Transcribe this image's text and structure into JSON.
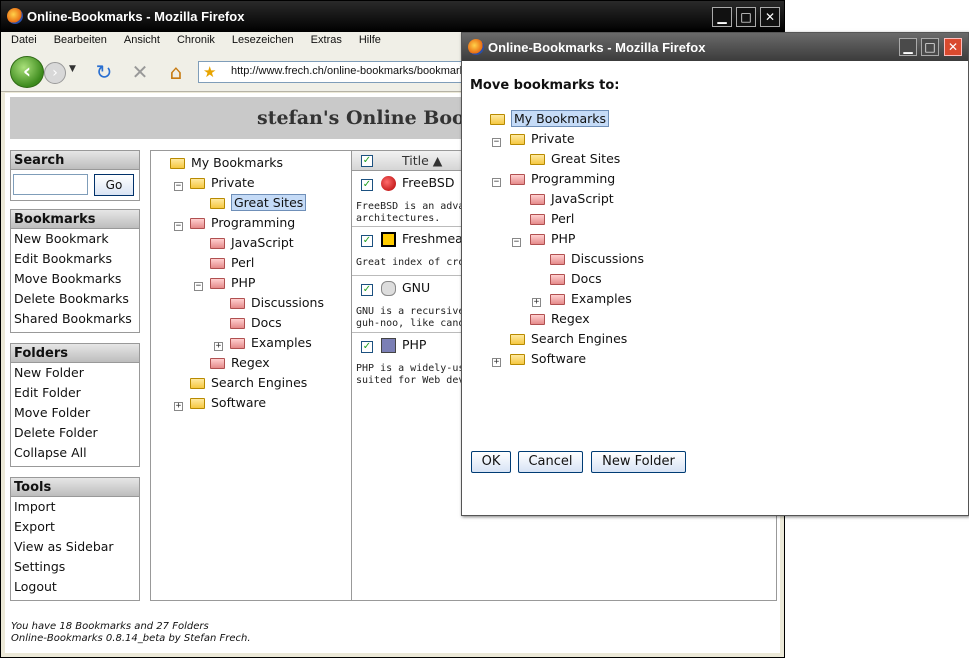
{
  "main_window": {
    "title": "Online-Bookmarks - Mozilla Firefox",
    "menu": [
      "Datei",
      "Bearbeiten",
      "Ansicht",
      "Chronik",
      "Lesezeichen",
      "Extras",
      "Hilfe"
    ],
    "url": "http://www.frech.ch/online-bookmarks/bookmarks.php"
  },
  "page": {
    "heading": "stefan's Online Bookmarks",
    "search": {
      "title": "Search",
      "value": "",
      "button": "Go"
    },
    "bookmarks_box": {
      "title": "Bookmarks",
      "items": [
        "New Bookmark",
        "Edit Bookmarks",
        "Move Bookmarks",
        "Delete Bookmarks",
        "Shared Bookmarks"
      ]
    },
    "folders_box": {
      "title": "Folders",
      "items": [
        "New Folder",
        "Edit Folder",
        "Move Folder",
        "Delete Folder",
        "Collapse All"
      ]
    },
    "tools_box": {
      "title": "Tools",
      "items": [
        "Import",
        "Export",
        "View as Sidebar",
        "Settings",
        "Logout"
      ]
    },
    "tree": [
      "My Bookmarks",
      "Private",
      "Great Sites",
      "Programming",
      "JavaScript",
      "Perl",
      "PHP",
      "Discussions",
      "Docs",
      "Examples",
      "Regex",
      "Search Engines",
      "Software"
    ],
    "list_header": "Title ▲",
    "bookmarks": [
      {
        "title": "FreeBSD",
        "desc1": "FreeBSD is an adva",
        "desc2": "architectures."
      },
      {
        "title": "Freshmea",
        "desc1": "Great index of cros",
        "desc2": ""
      },
      {
        "title": "GNU",
        "desc1": "GNU is a recursive ",
        "desc2": "guh-noo, like canoe"
      },
      {
        "title": "PHP",
        "desc1": "PHP is a widely-use",
        "desc2": "suited for Web dev"
      }
    ],
    "footer_1": "You have 18 Bookmarks and 27 Folders",
    "footer_2": "Online-Bookmarks 0.8.14_beta by Stefan Frech."
  },
  "dialog": {
    "title": "Online-Bookmarks - Mozilla Firefox",
    "heading": "Move bookmarks to:",
    "tree": [
      "My Bookmarks",
      "Private",
      "Great Sites",
      "Programming",
      "JavaScript",
      "Perl",
      "PHP",
      "Discussions",
      "Docs",
      "Examples",
      "Regex",
      "Search Engines",
      "Software"
    ],
    "buttons": {
      "ok": "OK",
      "cancel": "Cancel",
      "new_folder": "New Folder"
    }
  }
}
